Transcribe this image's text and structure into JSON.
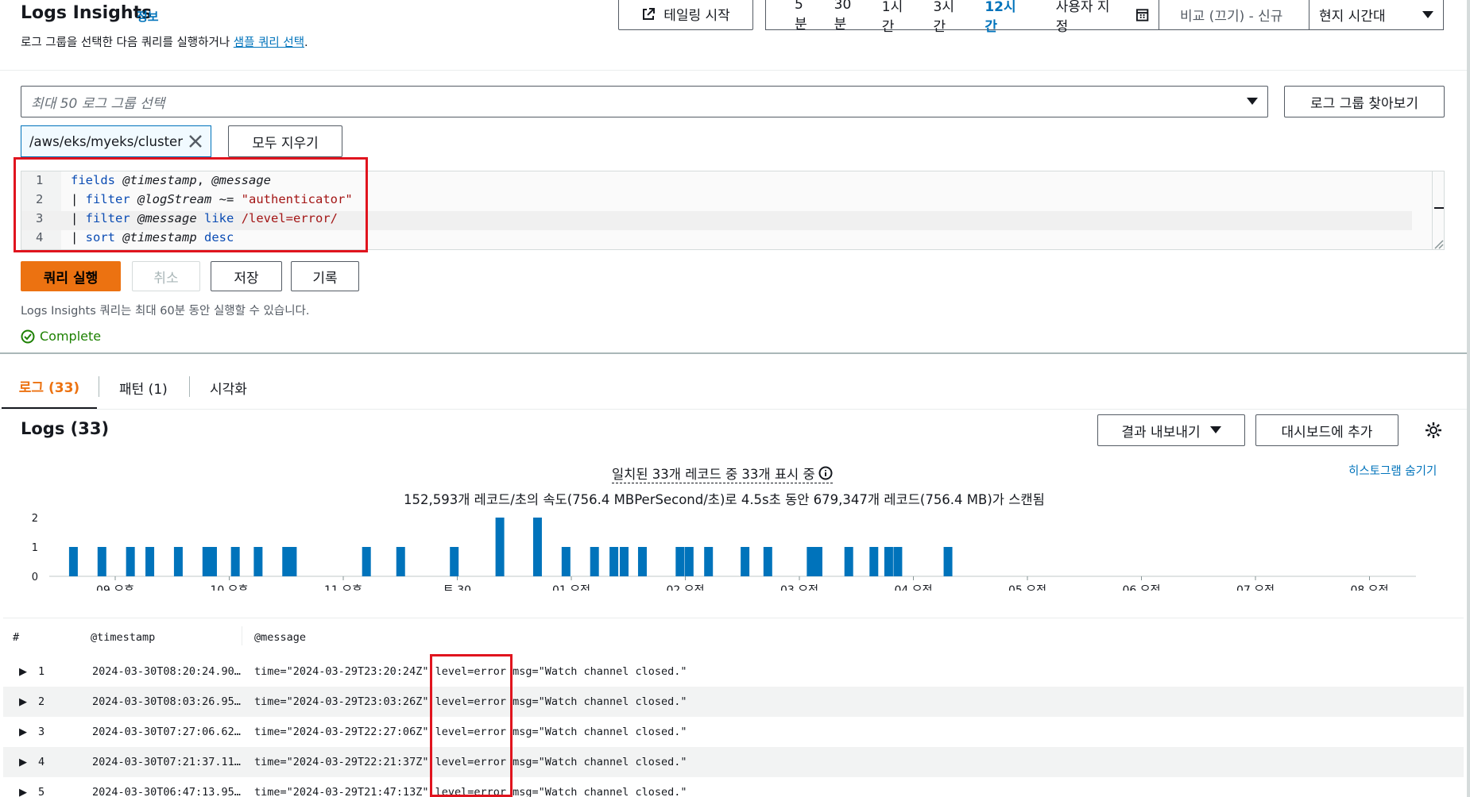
{
  "header": {
    "title": "Logs Insights",
    "info_link": "정보",
    "subtitle_prefix": "로그 그룹을 선택한 다음 쿼리를 실행하거나 ",
    "sample_link": "샘플 쿼리 선택",
    "subtitle_suffix": ".",
    "tailing_button": "테일링 시작"
  },
  "time_range": {
    "options": [
      "5분",
      "30분",
      "1시간",
      "3시간",
      "12시간"
    ],
    "selected": "12시간",
    "custom_label": "사용자 지정",
    "compare_label": "비교 (끄기) - 신규",
    "timezone_label": "현지 시간대"
  },
  "log_group_select": {
    "placeholder": "최대 50 로그 그룹 선택",
    "browse_button": "로그 그룹 찾아보기",
    "selected_token": "/aws/eks/myeks/cluster",
    "clear_all_button": "모두 지우기"
  },
  "query_editor": {
    "lines": [
      {
        "n": "1",
        "text": "fields @timestamp, @message"
      },
      {
        "n": "2",
        "text": "| filter @logStream ~= \"authenticator\""
      },
      {
        "n": "3",
        "text": "| filter @message like /level=error/"
      },
      {
        "n": "4",
        "text": "| sort @timestamp desc"
      }
    ]
  },
  "actions": {
    "run": "쿼리 실행",
    "cancel": "취소",
    "save": "저장",
    "history": "기록",
    "note": "Logs Insights 쿼리는 최대 60분 동안 실행할 수 있습니다.",
    "status": "Complete"
  },
  "tabs": {
    "logs": "로그 (33)",
    "patterns": "패턴 (1)",
    "visualization": "시각화"
  },
  "results": {
    "title": "Logs (33)",
    "export_button": "결과 내보내기",
    "dashboard_button": "대시보드에 추가",
    "matched_text": "일치된 33개 레코드 중 33개 표시 중",
    "scan_text": "152,593개 레코드/초의 속도(756.4 MBPerSecond/초)로 4.5s초 동안 679,347개 레코드(756.4 MB)가 스캔됨",
    "hide_histogram": "히스토그램 숨기기"
  },
  "chart_data": {
    "type": "bar",
    "title": "",
    "xlabel": "",
    "ylabel": "",
    "ylim": [
      0,
      2
    ],
    "y_ticks": [
      "0",
      "1",
      "2"
    ],
    "x_tick_labels": [
      "09 오후",
      "10 오후",
      "11 오후",
      "토 30",
      "01 오전",
      "02 오전",
      "03 오전",
      "04 오전",
      "05 오전",
      "06 오전",
      "07 오전",
      "08 오전"
    ],
    "x_tick_positions_hours": [
      0,
      1,
      2,
      3,
      4,
      5,
      6,
      7,
      8,
      9,
      10,
      11
    ],
    "bars_hours_offset": [
      -0.37,
      -0.12,
      0.13,
      0.3,
      0.55,
      0.8,
      0.85,
      1.05,
      1.25,
      1.5,
      1.55,
      2.2,
      2.5,
      2.97,
      3.37,
      3.7,
      3.95,
      4.2,
      4.37,
      4.46,
      4.62,
      4.95,
      5.03,
      5.2,
      5.52,
      5.72,
      6.1,
      6.16,
      6.43,
      6.65,
      6.78,
      6.86,
      7.3
    ],
    "values": [
      1,
      1,
      1,
      1,
      1,
      1,
      1,
      1,
      1,
      1,
      1,
      1,
      1,
      1,
      2,
      2,
      1,
      1,
      1,
      1,
      1,
      1,
      1,
      1,
      1,
      1,
      1,
      1,
      1,
      1,
      1,
      1,
      1
    ],
    "series": [
      {
        "values": []
      }
    ],
    "grid": false,
    "color": "#0073bb"
  },
  "table": {
    "headers": [
      "#",
      "@timestamp",
      "@message"
    ],
    "rows": [
      {
        "n": "1",
        "timestamp": "2024-03-30T08:20:24.90…",
        "message": "time=\"2024-03-29T23:20:24Z\" level=error msg=\"Watch channel closed.\""
      },
      {
        "n": "2",
        "timestamp": "2024-03-30T08:03:26.95…",
        "message": "time=\"2024-03-29T23:03:26Z\" level=error msg=\"Watch channel closed.\""
      },
      {
        "n": "3",
        "timestamp": "2024-03-30T07:27:06.62…",
        "message": "time=\"2024-03-29T22:27:06Z\" level=error msg=\"Watch channel closed.\""
      },
      {
        "n": "4",
        "timestamp": "2024-03-30T07:21:37.11…",
        "message": "time=\"2024-03-29T22:21:37Z\" level=error msg=\"Watch channel closed.\""
      },
      {
        "n": "5",
        "timestamp": "2024-03-30T06:47:13.95…",
        "message": "time=\"2024-03-29T21:47:13Z\" level=error msg=\"Watch channel closed.\""
      }
    ]
  },
  "colors": {
    "accent": "#ec7211",
    "link": "#0073bb",
    "highlight": "#e0141e",
    "success": "#1d8102",
    "bar": "#0073bb"
  }
}
